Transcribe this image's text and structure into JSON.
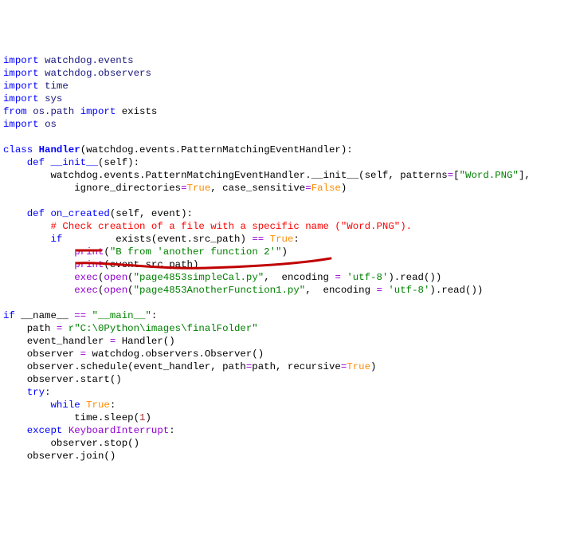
{
  "tokens": {
    "import": "import",
    "from": "from",
    "class": "class",
    "def": "def",
    "if": "if",
    "while": "while",
    "try": "try",
    "except": "except",
    "eqeq": "==",
    "eq": "="
  },
  "l1": {
    "m1": "watchdog.events"
  },
  "l2": {
    "m1": "watchdog.observers"
  },
  "l3": {
    "m1": "time"
  },
  "l4": {
    "m1": "sys"
  },
  "l5": {
    "m1": "os.path",
    "m2": "exists"
  },
  "l6": {
    "m1": "os"
  },
  "l8": {
    "name": "Handler",
    "base": "(watchdog.events.PatternMatchingEventHandler):"
  },
  "l9": {
    "fn": "__init__",
    "sig": "(self):"
  },
  "l10": {
    "pre": "        watchdog.events.PatternMatchingEventHandler.",
    "fn": "__init__",
    "post1": "(self, patterns",
    "str": "\"Word.PNG\"",
    "post2": "],"
  },
  "l11": {
    "pre": "            ignore_directories",
    "v1": "True",
    "mid": ", case_sensitive",
    "v2": "False",
    "end": ")"
  },
  "l13": {
    "fn": "on_created",
    "sig": "(self, event):"
  },
  "l14": {
    "txt": "# Check creation of a file with a specific name (\"Word.PNG\")."
  },
  "l15": {
    "pre": "         exists(event.src_path) ",
    "v": "True",
    "end": ":"
  },
  "l16": {
    "fn": "print",
    "str": "\"B from 'another function 2'\""
  },
  "l17": {
    "fn": "print",
    "arg": "(event.src_path)"
  },
  "l18": {
    "fn1": "exec",
    "fn2": "open",
    "str": "\"page4853simpleCal.py\"",
    "mid": ",  encoding ",
    "str2": "'utf-8'",
    "end": ").read())"
  },
  "l19": {
    "fn1": "exec",
    "fn2": "open",
    "str": "\"page4853AnotherFunction1.py\"",
    "mid": ",  encoding ",
    "str2": "'utf-8'",
    "end": ").read())"
  },
  "l21": {
    "pre": " __name__ ",
    "str": "\"__main__\"",
    "end": ":"
  },
  "l22": {
    "pre": "    path ",
    "str": "r\"C:\\0Python\\images\\finalFolder\""
  },
  "l23": {
    "pre": "    event_handler ",
    "post": " Handler()"
  },
  "l24": {
    "pre": "    observer ",
    "post": " watchdog.observers.Observer()"
  },
  "l25": {
    "pre": "    observer.schedule(event_handler, path",
    "mid": "path, recursive",
    "v": "True",
    "end": ")"
  },
  "l26": {
    "txt": "    observer.start()"
  },
  "l27": {
    "end": ":"
  },
  "l28": {
    "v": "True",
    "end": ":"
  },
  "l29": {
    "pre": "            time.sleep(",
    "num": "1",
    "end": ")"
  },
  "l30": {
    "exc": "KeyboardInterrupt",
    "end": ":"
  },
  "l31": {
    "txt": "        observer.stop()"
  },
  "l32": {
    "txt": "    observer.join()"
  }
}
